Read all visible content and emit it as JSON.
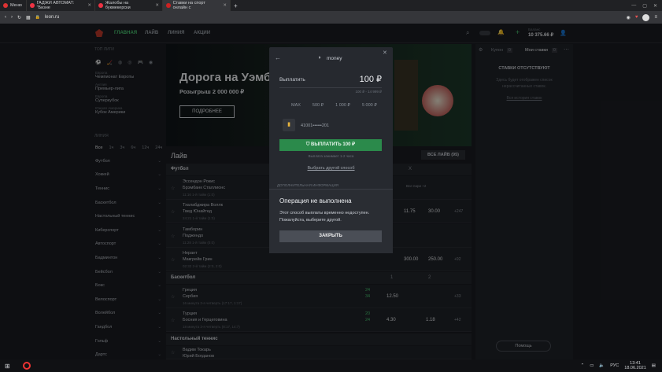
{
  "browser": {
    "menu_label": "Меню",
    "tabs": [
      {
        "title": "ГАДЖИ АВТОМАТ: \"Бизне"
      },
      {
        "title": "Жалобы на букмекерски"
      },
      {
        "title": "Ставки на спорт онлайн с"
      }
    ],
    "url": "leon.ru"
  },
  "site": {
    "nav": [
      "ГЛАВНАЯ",
      "ЛАЙВ",
      "ЛИНИЯ",
      "АКЦИИ"
    ],
    "balance_label": "Баланс",
    "balance_value": "10 375.66 ₽"
  },
  "sidebar": {
    "top_leagues_label": "ТОП ЛИГИ",
    "leagues": [
      {
        "country": "Европа",
        "name": "Чемпионат Европы"
      },
      {
        "country": "Англия",
        "name": "Премьер-лига"
      },
      {
        "country": "Европа",
        "name": "Суперкубок"
      },
      {
        "country": "Южная Америка",
        "name": "Кубок Америки"
      }
    ],
    "line_label": "ЛИНИЯ",
    "time_filters": [
      "Все",
      "1ч",
      "3ч",
      "6ч",
      "12ч",
      "24ч"
    ],
    "sports": [
      "Футбол",
      "Хоккей",
      "Теннис",
      "Баскетбол",
      "Настольный теннис",
      "Киберспорт",
      "Автоспорт",
      "Бадминтон",
      "Бейсбол",
      "Бокс",
      "Велоспорт",
      "Волейбол",
      "Гандбол",
      "Гольф",
      "Дартс"
    ]
  },
  "banner": {
    "title": "Дорога на Уэмбли",
    "subtitle": "Розыгрыш 2 000 000 ₽",
    "button": "ПОДРОБНЕЕ"
  },
  "live": {
    "title": "Лайв",
    "all_button": "ВСЕ ЛАЙВ (95)",
    "football_label": "Футбол",
    "col_1": "1",
    "col_x": "X",
    "col_2": "2",
    "all_pairs": "Все пари +2",
    "matches": [
      {
        "team1": "Эссендон Рокис",
        "team2": "Брэмбанк Сталлионс",
        "meta": "11:16 1-й тайм (1:0)"
      },
      {
        "team1": "Тхалабджира Воллк",
        "team2": "Твед Юнайтед",
        "meta": "24:21 1-й тайм (1:0)",
        "o1": "11.75",
        "o2": "30.00",
        "more": "+247"
      },
      {
        "team1": "Тамборин",
        "team2": "Поджендо",
        "meta": "11:28 1-й тайм (0:0)"
      },
      {
        "team1": "Нерант",
        "team2": "Макгрейв Грин",
        "meta": "02:32 2-й тайм (2:0, 2:0)",
        "o1": "300.00",
        "o2": "250.00",
        "more": "+92"
      }
    ],
    "basketball_label": "Баскетбол",
    "basket_matches": [
      {
        "team1": "Греция",
        "team2": "Сербия",
        "meta": "16 минута 3-я четверть (17:17, 1:17)",
        "s1": "24",
        "s2": "34",
        "o1": "12.50",
        "more": "+33"
      },
      {
        "team1": "Турция",
        "team2": "Босния и Герцеговина",
        "meta": "18 минута 3-я четверть (8:17, 14:7)",
        "s1": "20",
        "s2": "24",
        "o1": "4.30",
        "o2": "1.18",
        "more": "+42"
      }
    ],
    "tennis_label": "Настольный теннис",
    "tennis_match": {
      "team1": "Вадим Токарь",
      "team2": "Юрий Богданов"
    }
  },
  "betslip": {
    "tab_coupon": "Купон",
    "tab_coupon_count": "0",
    "tab_mybets": "Мои ставки",
    "tab_mybets_count": "0",
    "empty_title": "СТАВКИ ОТСУТСТВУЮТ",
    "empty_text": "Здесь будет отображен список нерассчитанных ставок.",
    "history_link": "Вся история ставок",
    "help_button": "Помощь"
  },
  "withdraw": {
    "provider": "money",
    "label": "Выплатить",
    "amount": "100 ₽",
    "range": "100 ₽ - 14 999 ₽",
    "presets": [
      "MAX",
      "500 ₽",
      "1 000 ₽",
      "5 000 ₽"
    ],
    "wallet": "41001••••••201",
    "submit": "ВЫПЛАТИТЬ 100 ₽",
    "note": "Выплата занимает 1-2 часа",
    "other_method": "Выбрать другой способ",
    "extra_info": "ДОПОЛНИТЕЛЬНАЯ ИНФОРМАЦИЯ"
  },
  "error": {
    "title": "Операция не выполнена",
    "message": "Этот способ выплаты временно недоступен. Пожалуйста, выберите другой.",
    "close": "ЗАКРЫТЬ"
  },
  "taskbar": {
    "lang": "РУС",
    "time": "13:41",
    "date": "18.06.2021"
  },
  "colors": {
    "accent": "#49c672",
    "button_green": "#2b8a4b"
  }
}
